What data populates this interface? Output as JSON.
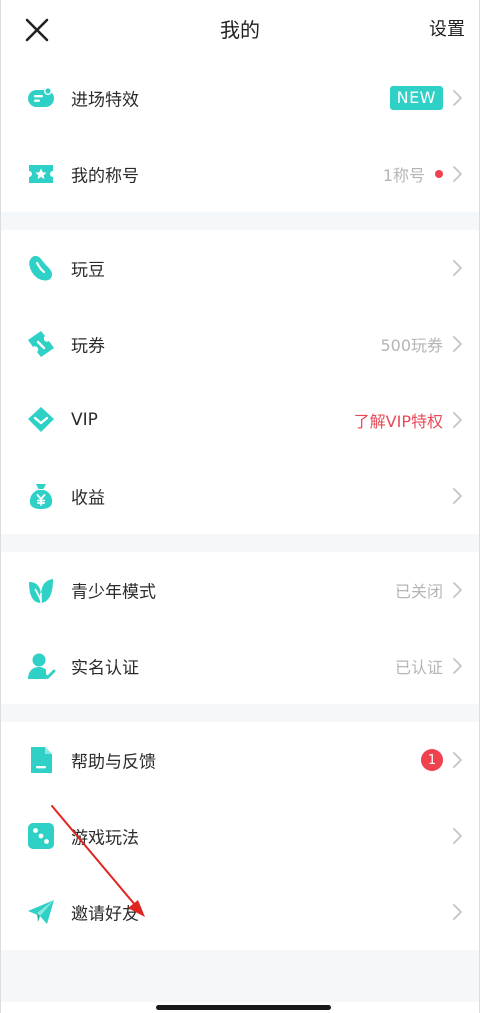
{
  "header": {
    "title": "我的",
    "settings_label": "设置"
  },
  "sections": {
    "s1": {
      "entrance_effects": {
        "label": "进场特效",
        "badge": "NEW"
      },
      "my_titles": {
        "label": "我的称号",
        "value": "1称号"
      }
    },
    "s2": {
      "beans": {
        "label": "玩豆",
        "value": ""
      },
      "tickets": {
        "label": "玩券",
        "value": "500玩券"
      },
      "vip": {
        "label": "VIP",
        "value": "了解VIP特权"
      },
      "earnings": {
        "label": "收益",
        "value": ""
      }
    },
    "s3": {
      "youth_mode": {
        "label": "青少年模式",
        "value": "已关闭"
      },
      "real_name": {
        "label": "实名认证",
        "value": "已认证"
      }
    },
    "s4": {
      "help": {
        "label": "帮助与反馈",
        "count": "1"
      },
      "gameplay": {
        "label": "游戏玩法"
      },
      "invite": {
        "label": "邀请好友"
      }
    }
  },
  "colors": {
    "accent": "#2fd1c6",
    "badge_red": "#f0424e",
    "vip_red": "#e84a57",
    "section_gap": "#f4f8fa",
    "annotation_arrow": "#e0241f"
  },
  "icons": {
    "close": "close-icon",
    "entrance_effects": "ticket-chat-icon",
    "my_titles": "star-card-icon",
    "beans": "bean-icon",
    "tickets": "coupon-icon",
    "vip": "diamond-icon",
    "earnings": "money-bag-icon",
    "youth_mode": "leaf-icon",
    "real_name": "user-check-icon",
    "help": "document-icon",
    "gameplay": "dice-icon",
    "invite": "paper-plane-icon",
    "chevron": "chevron-right-icon"
  }
}
